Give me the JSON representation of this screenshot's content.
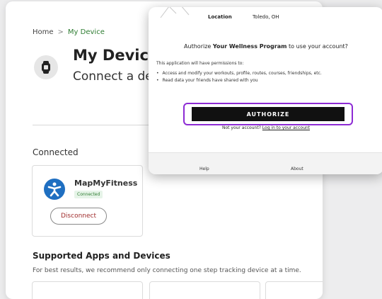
{
  "breadcrumb": {
    "home": "Home",
    "separator": ">",
    "current": "My Device"
  },
  "device": {
    "title": "My Device",
    "subtitle": "Connect a device",
    "icon": "watch-icon"
  },
  "connected": {
    "heading": "Connected",
    "app": {
      "name": "MapMyFitness",
      "status": "Connected",
      "action": "Disconnect",
      "logo": "running-figure-icon"
    }
  },
  "supported": {
    "heading": "Supported Apps and Devices",
    "description": "For best results, we recommend only connecting one step tracking device at a time."
  },
  "modal": {
    "location_label": "Location",
    "location_value": "Toledo, OH",
    "authorize_prefix": "Authorize",
    "authorize_program": "Your Wellness Program",
    "authorize_suffix": "to use your account?",
    "permissions_intro": "This application will have permissions to:",
    "permissions": [
      "Access and modify your workouts, profile, routes, courses, friendships, etc.",
      "Read data your friends have shared with you"
    ],
    "authorize_button": "AUTHORIZE",
    "not_account": "Not your account?",
    "login_link": "Log in to your account",
    "footer": {
      "help": "Help",
      "about": "About"
    }
  },
  "colors": {
    "highlight": "#8d2bd4",
    "accent_green": "#2e7d32",
    "button_dark": "#111111",
    "logo_blue": "#1f6fc1"
  }
}
